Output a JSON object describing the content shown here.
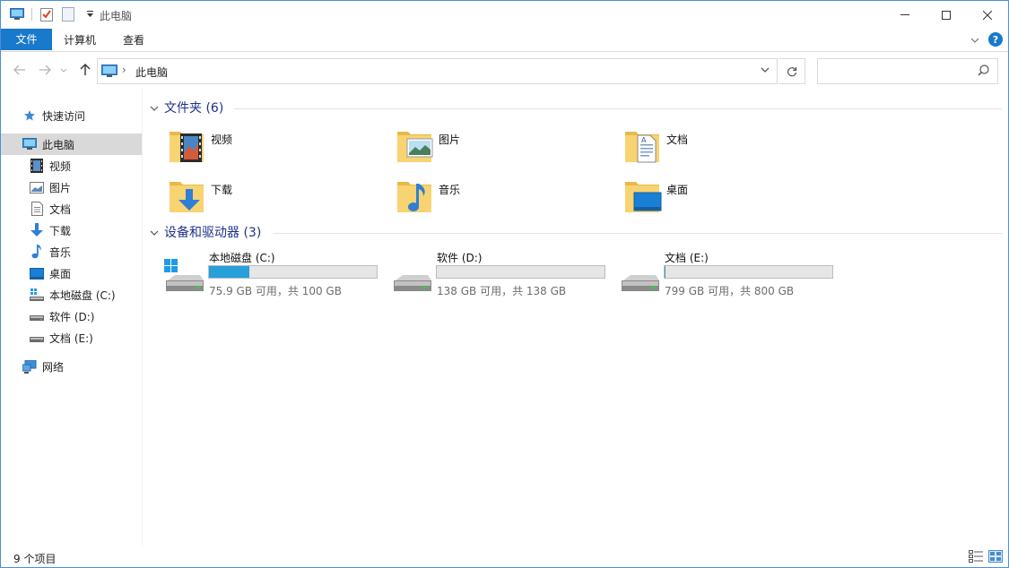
{
  "window": {
    "title": "此电脑"
  },
  "ribbon": {
    "tabs": [
      "文件",
      "计算机",
      "查看"
    ]
  },
  "address": {
    "crumb": "此电脑",
    "search_placeholder": ""
  },
  "nav": {
    "items": [
      {
        "label": "快速访问",
        "icon": "star-icon"
      },
      {
        "label": "此电脑",
        "icon": "computer-icon",
        "selected": true
      },
      {
        "label": "视频",
        "icon": "video-icon"
      },
      {
        "label": "图片",
        "icon": "pictures-icon"
      },
      {
        "label": "文档",
        "icon": "documents-icon"
      },
      {
        "label": "下载",
        "icon": "download-icon"
      },
      {
        "label": "音乐",
        "icon": "music-icon"
      },
      {
        "label": "桌面",
        "icon": "desktop-icon"
      },
      {
        "label": "本地磁盘 (C:)",
        "icon": "windows-drive-icon"
      },
      {
        "label": "软件 (D:)",
        "icon": "drive-icon"
      },
      {
        "label": "文档 (E:)",
        "icon": "drive-icon"
      },
      {
        "label": "网络",
        "icon": "network-icon"
      }
    ]
  },
  "groups": {
    "folders": {
      "title": "文件夹 (6)",
      "items": [
        {
          "label": "视频",
          "icon": "video-folder-icon"
        },
        {
          "label": "图片",
          "icon": "pictures-folder-icon"
        },
        {
          "label": "文档",
          "icon": "documents-folder-icon"
        },
        {
          "label": "下载",
          "icon": "download-folder-icon"
        },
        {
          "label": "音乐",
          "icon": "music-folder-icon"
        },
        {
          "label": "桌面",
          "icon": "desktop-folder-icon"
        }
      ]
    },
    "drives": {
      "title": "设备和驱动器 (3)",
      "items": [
        {
          "label": "本地磁盘 (C:)",
          "free": "75.9 GB 可用，共 100 GB",
          "used_fraction": 0.241,
          "icon": "windows-drive-icon"
        },
        {
          "label": "软件 (D:)",
          "free": "138 GB 可用，共 138 GB",
          "used_fraction": 0.0,
          "icon": "drive-icon"
        },
        {
          "label": "文档 (E:)",
          "free": "799 GB 可用，共 800 GB",
          "used_fraction": 0.001,
          "icon": "drive-icon"
        }
      ]
    }
  },
  "status": {
    "count": "9 个项目"
  },
  "colors": {
    "accent": "#1979ca",
    "bar_fill": "#26a0da",
    "group_title": "#1e3287"
  }
}
